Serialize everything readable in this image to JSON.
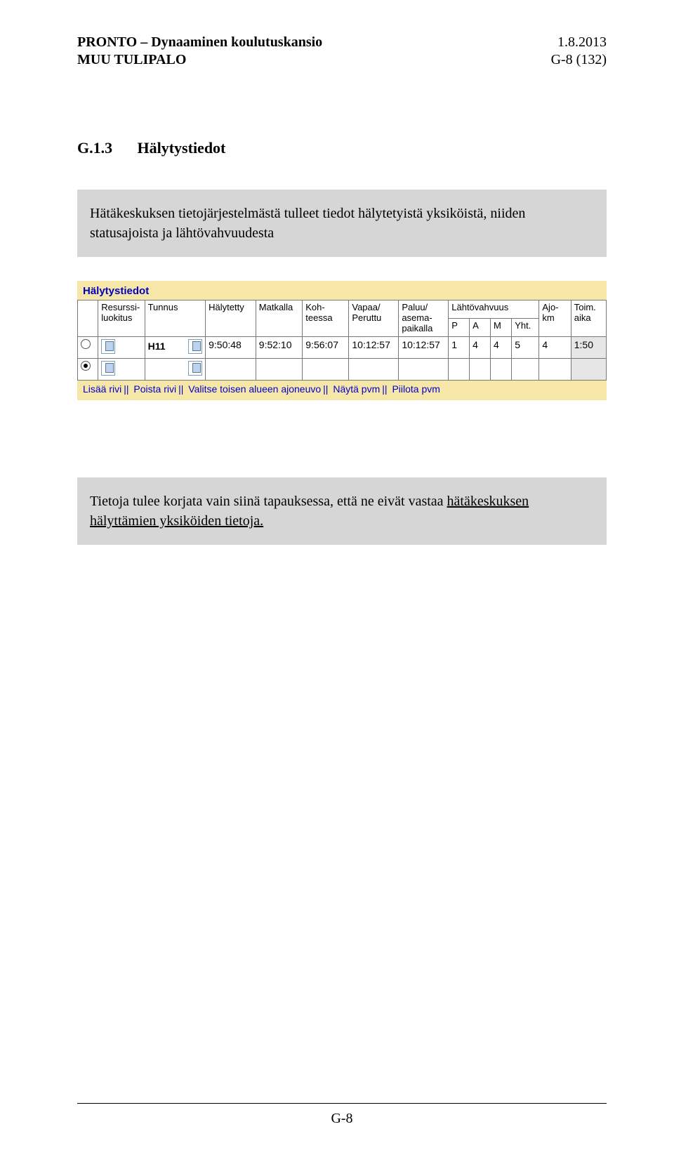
{
  "header": {
    "title_line1": "PRONTO – Dynaaminen koulutuskansio",
    "title_line2": "MUU TULIPALO",
    "date": "1.8.2013",
    "pageref": "G-8 (132)"
  },
  "section": {
    "number": "G.1.3",
    "title": "Hälytystiedot"
  },
  "lead": "Hätäkeskuksen tietojärjestelmästä tulleet tiedot hälytetyistä yksiköistä, niiden statusajoista ja lähtövahvuudesta",
  "panel": {
    "title": "Hälytystiedot",
    "columns": {
      "resurssi": "Resurssi-\nluokitus",
      "tunnus": "Tunnus",
      "halytetty": "Hälytetty",
      "matkalla": "Matkalla",
      "kohteessa": "Koh-\nteessa",
      "vapaa": "Vapaa/\nPeruttu",
      "paluu": "Paluu/\nasema-\npaikalla",
      "lahtov": "Lähtövahvuus",
      "p": "P",
      "a": "A",
      "m": "M",
      "yht": "Yht.",
      "ajokm": "Ajo-\nkm",
      "toimaika": "Toim.\naika"
    },
    "rows": [
      {
        "selected": false,
        "tunnus": "H11",
        "halytetty": "9:50:48",
        "matkalla": "9:52:10",
        "kohteessa": "9:56:07",
        "vapaa": "10:12:57",
        "paluu": "10:12:57",
        "p": "1",
        "a": "4",
        "m": "4",
        "yht": "5",
        "ajokm": "4",
        "toimaika": "1:50"
      },
      {
        "selected": true,
        "tunnus": "",
        "halytetty": "",
        "matkalla": "",
        "kohteessa": "",
        "vapaa": "",
        "paluu": "",
        "p": "",
        "a": "",
        "m": "",
        "yht": "",
        "ajokm": "",
        "toimaika": ""
      }
    ],
    "links": [
      "Lisää rivi",
      "Poista rivi",
      "Valitse toisen alueen ajoneuvo",
      "Näytä pvm",
      "Piilota pvm"
    ]
  },
  "note": {
    "pre": "Tietoja tulee korjata vain siinä tapauksessa, että ne eivät vastaa ",
    "u": "hätäkeskuksen hälyttämien yksiköiden tietoja."
  },
  "footer": {
    "page": "G-8"
  }
}
